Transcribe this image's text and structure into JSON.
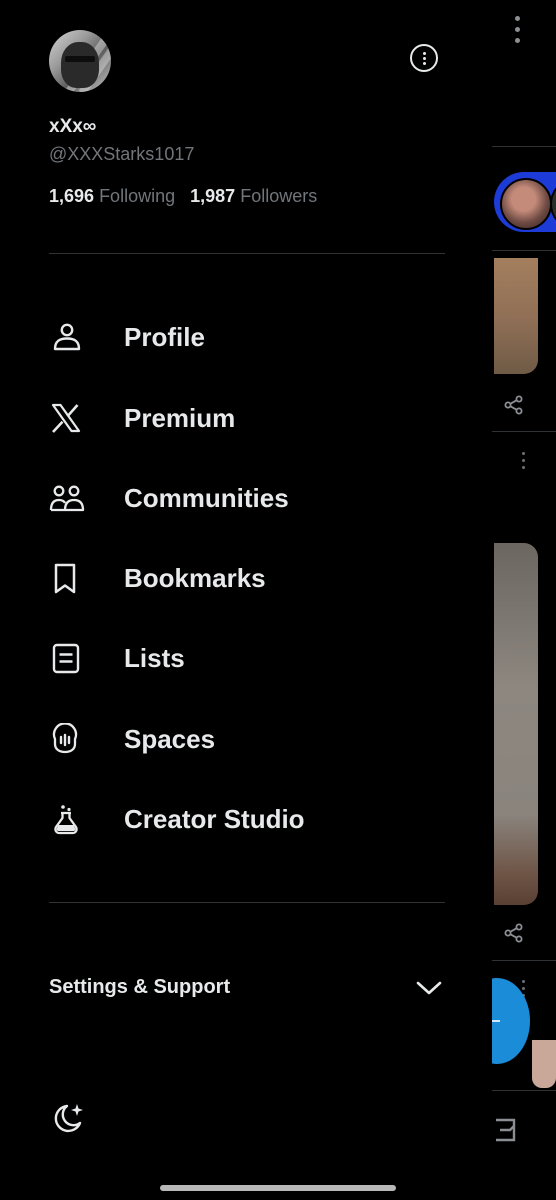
{
  "profile": {
    "display_name": "xXx∞",
    "handle": "@XXXStarks1017",
    "following_count": "1,696",
    "following_label": "Following",
    "followers_count": "1,987",
    "followers_label": "Followers"
  },
  "menu": {
    "items": [
      {
        "label": "Profile",
        "icon": "person-icon"
      },
      {
        "label": "Premium",
        "icon": "x-logo-icon"
      },
      {
        "label": "Communities",
        "icon": "communities-icon"
      },
      {
        "label": "Bookmarks",
        "icon": "bookmark-icon"
      },
      {
        "label": "Lists",
        "icon": "list-icon"
      },
      {
        "label": "Spaces",
        "icon": "spaces-icon"
      },
      {
        "label": "Creator Studio",
        "icon": "flask-icon"
      }
    ]
  },
  "settings": {
    "label": "Settings & Support",
    "icon": "chevron-down-icon"
  },
  "footer": {
    "theme_icon": "moon-sparkle-icon"
  },
  "colors": {
    "background": "#000000",
    "text": "#e7e9ea",
    "secondary": "#71767b",
    "divider": "#2f3336",
    "accent_blue": "#1a8cd8"
  }
}
